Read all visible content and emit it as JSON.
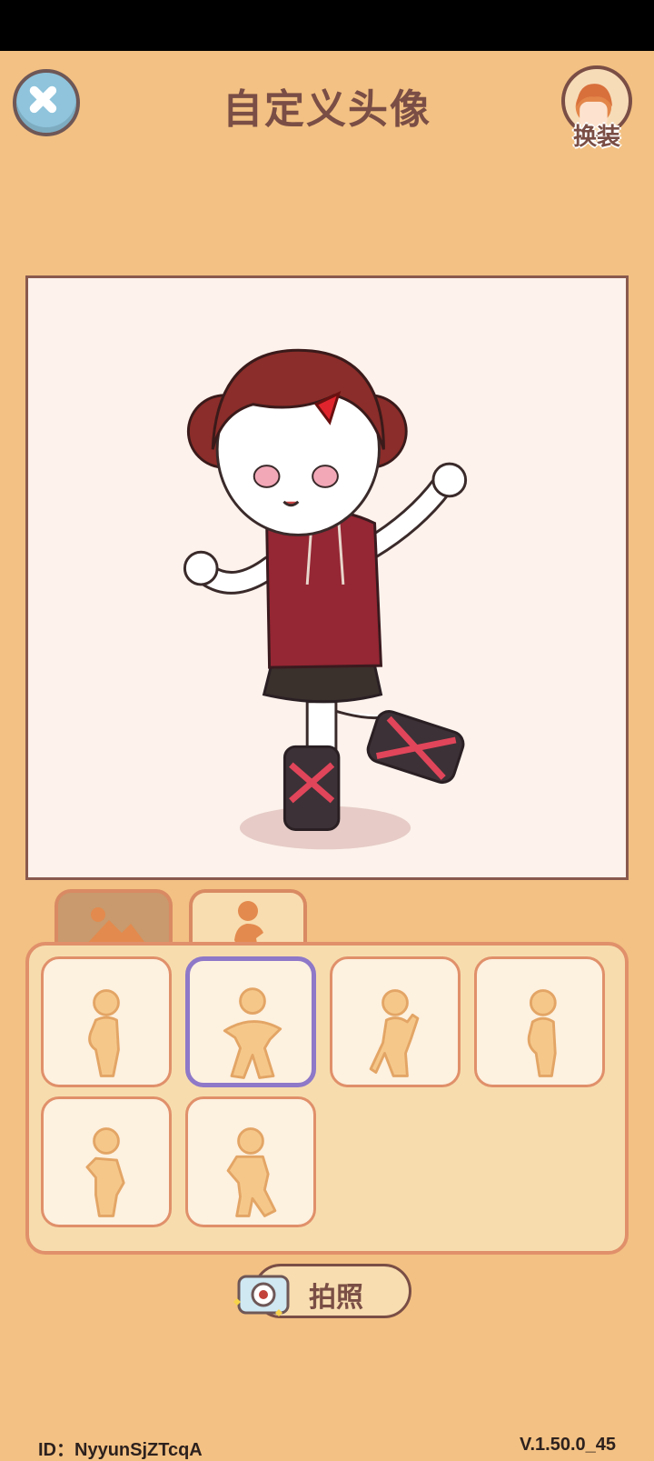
{
  "header": {
    "title": "自定义头像",
    "outfit_label": "换装"
  },
  "tabs": [
    {
      "name": "background",
      "icon": "mountain-icon",
      "active": false
    },
    {
      "name": "pose",
      "icon": "person-pose-icon",
      "active": true
    }
  ],
  "poses": [
    {
      "icon": "pose-hand-on-hip-icon",
      "selected": false
    },
    {
      "icon": "pose-arms-out-icon",
      "selected": true
    },
    {
      "icon": "pose-hand-to-face-icon",
      "selected": false
    },
    {
      "icon": "pose-side-stand-icon",
      "selected": false
    },
    {
      "icon": "pose-thinking-icon",
      "selected": false
    },
    {
      "icon": "pose-hands-to-cheek-icon",
      "selected": false
    }
  ],
  "photo_button": {
    "label": "拍照",
    "icon": "camera-icon"
  },
  "footer": {
    "id_text": "ID：NyyunSjZTcqA",
    "version": "V.1.50.0_45"
  },
  "colors": {
    "background": "#f3c183",
    "title": "#7a4e45",
    "panel": "#f7ddae",
    "selected_border": "#8e78c8",
    "close_button": "#8fc4dc"
  }
}
